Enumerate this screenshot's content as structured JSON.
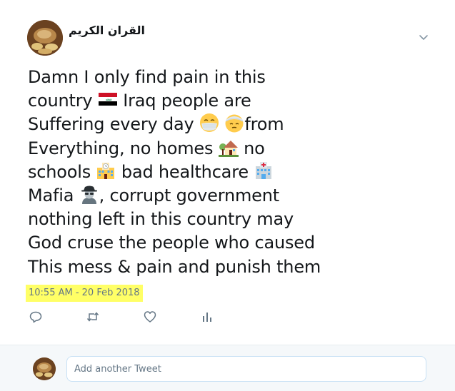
{
  "author": {
    "name": "القران الكريم"
  },
  "tweet": {
    "lines": [
      "Damn I only find pain in this",
      "country ",
      "Suffering every day ",
      "Everything, no homes ",
      "schools ",
      "Mafia ",
      "nothing left in this country may",
      "God cruse the people who caused",
      "This mess & pain and punish them"
    ],
    "segments": {
      "country_after": " Iraq people are",
      "suffering_after": "from",
      "homes_after": " no",
      "schools_after": " bad healthcare ",
      "mafia_after": ", corrupt government"
    },
    "emoji_names": [
      "iraq-flag-icon",
      "face-with-medical-mask-icon",
      "face-with-head-bandage-icon",
      "house-with-garden-icon",
      "school-icon",
      "hospital-icon",
      "detective-icon"
    ]
  },
  "timestamp": "10:55 AM - 20 Feb 2018",
  "timestamp_highlight": "#ffff66",
  "actions": {
    "reply_icon": "reply-icon",
    "retweet_icon": "retweet-icon",
    "like_icon": "heart-icon",
    "analytics_icon": "analytics-icon"
  },
  "reply": {
    "placeholder": "Add another Tweet"
  },
  "colors": {
    "text": "#14171a",
    "muted": "#657786",
    "footer_bg": "#f5f8fa",
    "input_border": "#c8e1f5"
  }
}
